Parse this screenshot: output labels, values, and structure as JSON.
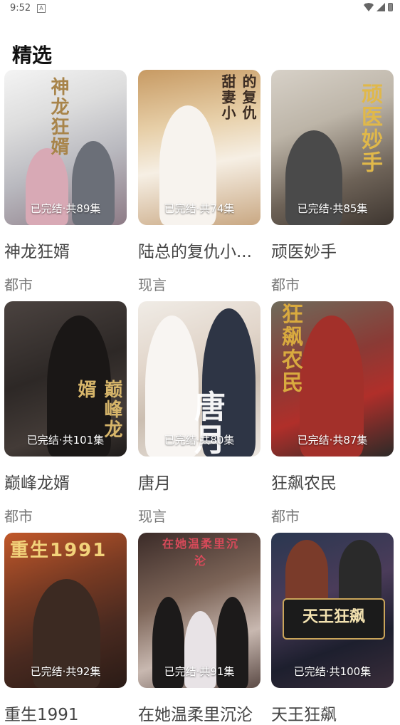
{
  "status_bar": {
    "time": "9:52",
    "notification_icon": "A"
  },
  "section": {
    "title": "精选"
  },
  "colors": {
    "badge_text": "#ffffff",
    "title_text": "#444444",
    "genre_text": "#777777"
  },
  "cards": [
    {
      "name": "神龙狂婿",
      "genre": "都市",
      "badge": "已完结·共89集",
      "cover_text": "神龙狂婿"
    },
    {
      "name": "陆总的复仇小...",
      "genre": "现言",
      "badge": "已完结·共74集",
      "cover_text": "的复仇甜妻小"
    },
    {
      "name": "顽医妙手",
      "genre": "都市",
      "badge": "已完结·共85集",
      "cover_text": "顽医妙手"
    },
    {
      "name": "巅峰龙婿",
      "genre": "都市",
      "badge": "已完结·共101集",
      "cover_text": "巅峰龙婿"
    },
    {
      "name": "唐月",
      "genre": "现言",
      "badge": "已完结·共80集",
      "cover_text": "唐月"
    },
    {
      "name": "狂飙农民",
      "genre": "都市",
      "badge": "已完结·共87集",
      "cover_text": "狂飙农民"
    },
    {
      "name": "重生1991",
      "genre": "",
      "badge": "已完结·共92集",
      "cover_text": "重生1991"
    },
    {
      "name": "在她温柔里沉沦",
      "genre": "",
      "badge": "已完结·共91集",
      "cover_text": "在她温柔里沉沦"
    },
    {
      "name": "天王狂飙",
      "genre": "",
      "badge": "已完结·共100集",
      "cover_text": "天王狂飙"
    }
  ]
}
